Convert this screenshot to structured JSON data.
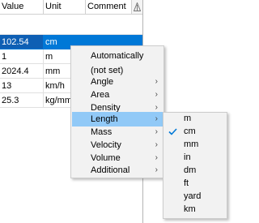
{
  "grid": {
    "headers": {
      "value": "Value",
      "unit": "Unit",
      "comment": "Comment"
    },
    "rows": [
      {
        "value": "102.54",
        "unit": "cm",
        "comment": "",
        "selected": true
      },
      {
        "value": "1",
        "unit": "m",
        "comment": ""
      },
      {
        "value": "2024.4",
        "unit": "mm",
        "comment": ""
      },
      {
        "value": "13",
        "unit": "km/h",
        "comment": ""
      },
      {
        "value": "25.3",
        "unit": "kg/mm",
        "comment": ""
      }
    ]
  },
  "menu": {
    "items": [
      {
        "label": "Automatically",
        "submenu": false
      },
      {
        "label": "(not set)",
        "submenu": false
      },
      {
        "label": "Angle",
        "submenu": true
      },
      {
        "label": "Area",
        "submenu": true
      },
      {
        "label": "Density",
        "submenu": true
      },
      {
        "label": "Length",
        "submenu": true,
        "highlighted": true
      },
      {
        "label": "Mass",
        "submenu": true
      },
      {
        "label": "Velocity",
        "submenu": true
      },
      {
        "label": "Volume",
        "submenu": true
      },
      {
        "label": "Additional",
        "submenu": true
      }
    ],
    "arrow_glyph": "›"
  },
  "submenu": {
    "items": [
      {
        "label": "m",
        "checked": false
      },
      {
        "label": "cm",
        "checked": true
      },
      {
        "label": "mm",
        "checked": false
      },
      {
        "label": "in",
        "checked": false
      },
      {
        "label": "dm",
        "checked": false
      },
      {
        "label": "ft",
        "checked": false
      },
      {
        "label": "yard",
        "checked": false
      },
      {
        "label": "km",
        "checked": false
      }
    ]
  },
  "colors": {
    "selection": "#0078d7",
    "menu_highlight": "#91c9f7",
    "checkmark": "#0078d7"
  }
}
